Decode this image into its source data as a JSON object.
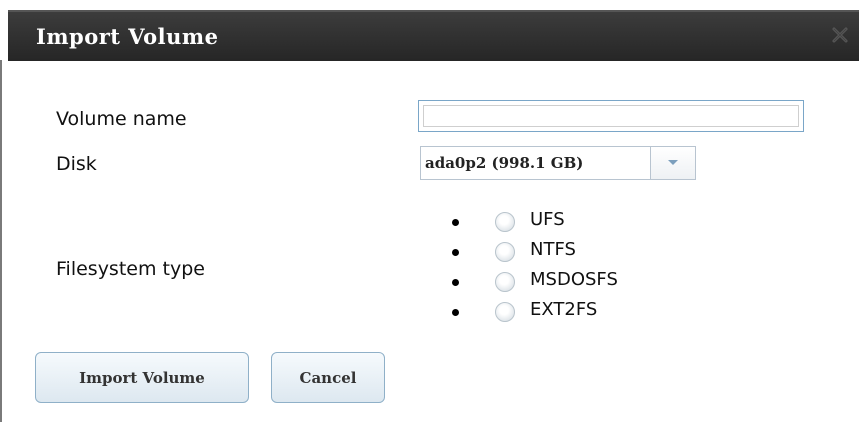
{
  "dialog": {
    "title": "Import Volume",
    "close_icon": "close-icon"
  },
  "form": {
    "volume_name_label": "Volume name",
    "volume_name_value": "",
    "disk_label": "Disk",
    "disk_selected": "ada0p2 (998.1 GB)",
    "filesystem_label": "Filesystem type",
    "filesystem_options": [
      "UFS",
      "NTFS",
      "MSDOSFS",
      "EXT2FS"
    ]
  },
  "buttons": {
    "import_label": "Import Volume",
    "cancel_label": "Cancel"
  },
  "colors": {
    "titlebar": "#2e2e2e",
    "input_border": "#7aa6c8",
    "button_border": "#8fb0c8"
  }
}
